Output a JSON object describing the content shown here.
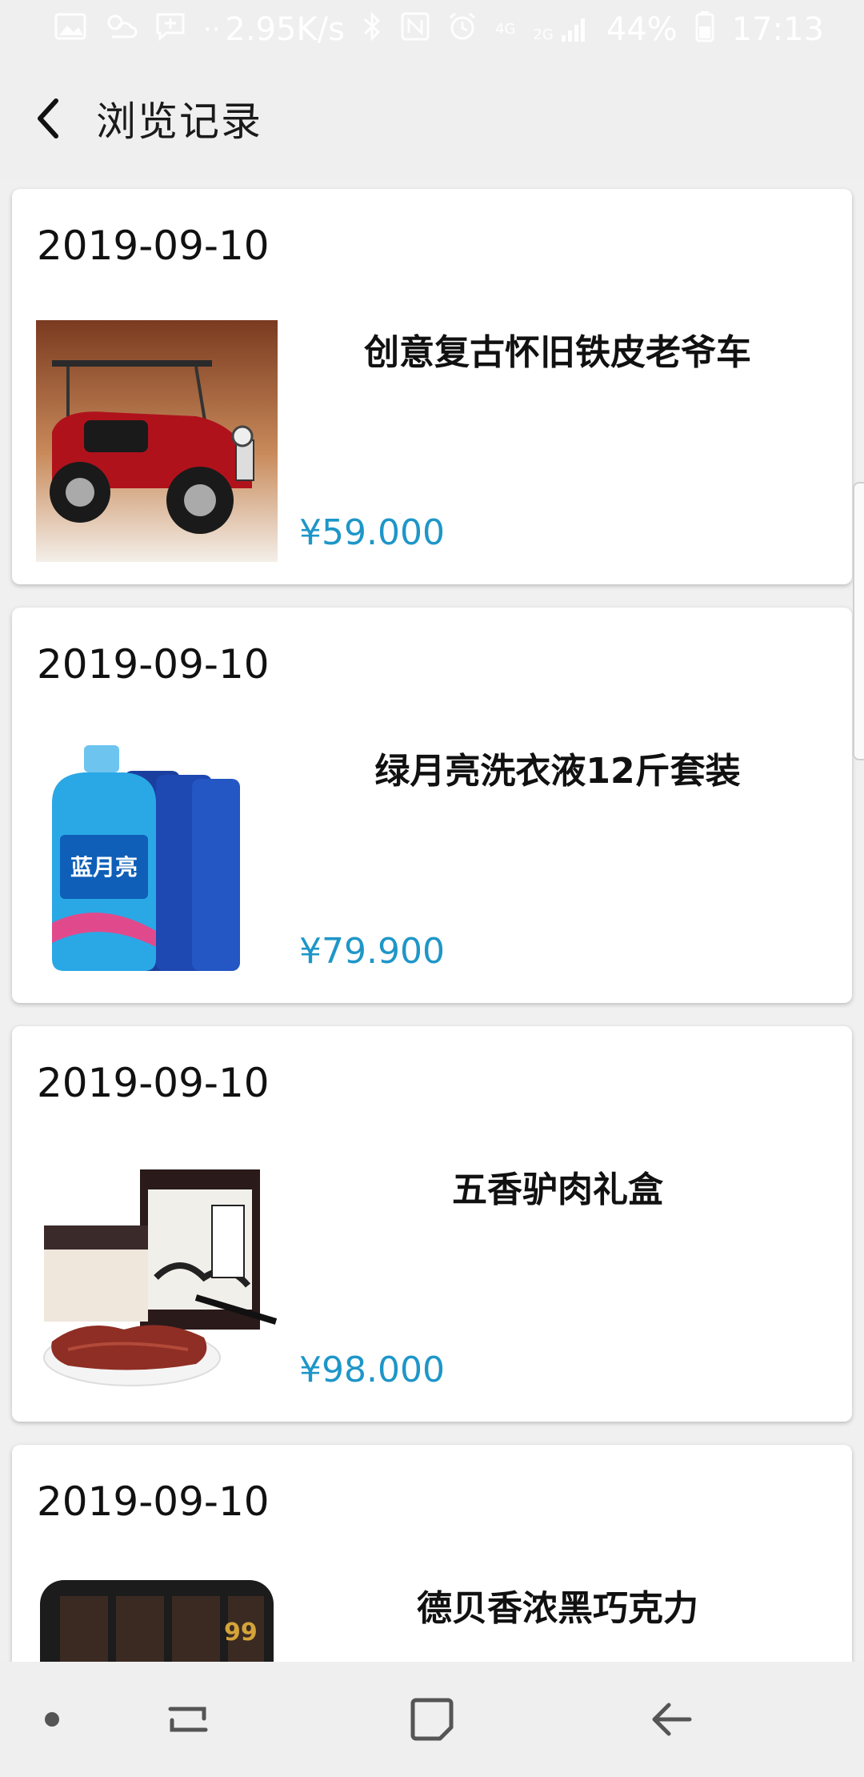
{
  "status_bar": {
    "speed": "2.95K/s",
    "battery": "44%",
    "time": "17:13",
    "net_top": "4G",
    "net_bottom": "2G"
  },
  "header": {
    "title": "浏览记录"
  },
  "items": [
    {
      "date": "2019-09-10",
      "name": "创意复古怀旧铁皮老爷车",
      "price": "¥59.000"
    },
    {
      "date": "2019-09-10",
      "name": "绿月亮洗衣液12斤套装",
      "price": "¥79.900"
    },
    {
      "date": "2019-09-10",
      "name": "五香驴肉礼盒",
      "price": "¥98.000"
    },
    {
      "date": "2019-09-10",
      "name": "德贝香浓黑巧克力",
      "price": ""
    }
  ],
  "colors": {
    "price": "#1e96c8",
    "bar_bg": "#efefef"
  }
}
